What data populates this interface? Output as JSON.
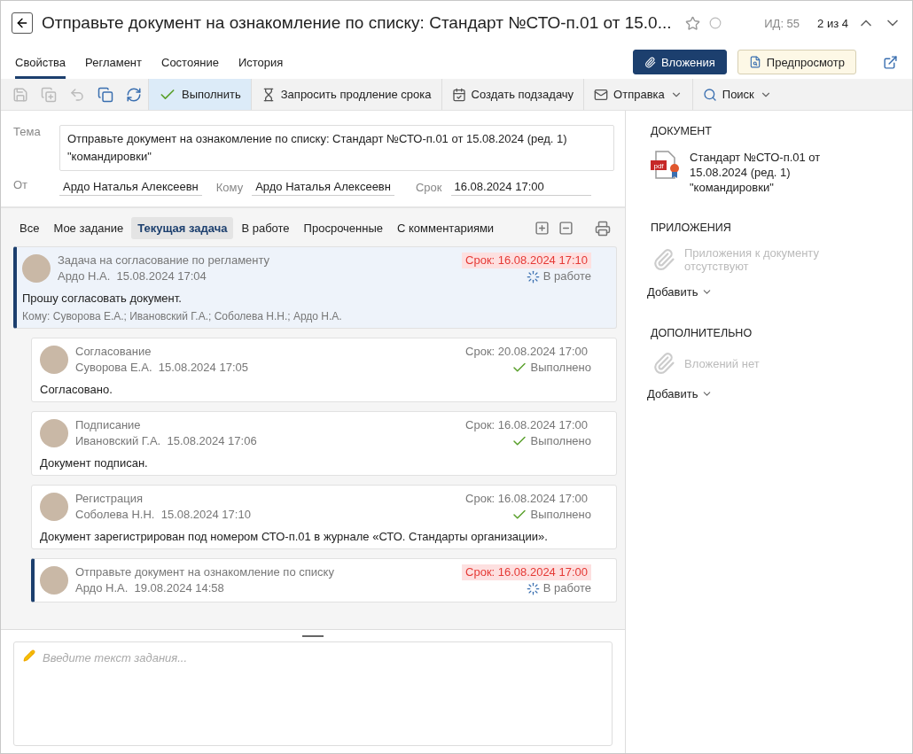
{
  "header": {
    "title": "Отправьте документ на ознакомление по списку: Стандарт №СТО-п.01 от 15.0...",
    "favorite": false,
    "id_label": "ИД: 55",
    "position": "2 из 4"
  },
  "tabs": [
    {
      "label": "Свойства",
      "selected": true
    },
    {
      "label": "Регламент",
      "selected": false
    },
    {
      "label": "Состояние",
      "selected": false
    },
    {
      "label": "История",
      "selected": false
    }
  ],
  "header_buttons": [
    {
      "label": "Вложения",
      "kind": "primary"
    },
    {
      "label": "Предпросмотр",
      "kind": "secondary"
    }
  ],
  "toolbar": [
    {
      "kind": "icon",
      "disabled": true
    },
    {
      "kind": "icon",
      "disabled": true
    },
    {
      "kind": "icon",
      "disabled": true
    },
    {
      "kind": "icon",
      "disabled": false
    },
    {
      "kind": "icon",
      "disabled": false
    },
    {
      "kind": "action",
      "label": "Выполнить",
      "selected": true,
      "menu": false
    },
    {
      "kind": "action",
      "label": "Запросить продление срока",
      "selected": false,
      "menu": false
    },
    {
      "kind": "action",
      "label": "Создать подзадачу",
      "selected": false,
      "menu": false
    },
    {
      "kind": "action",
      "label": "Отправка",
      "selected": false,
      "menu": true
    },
    {
      "kind": "action",
      "label": "Поиск",
      "selected": false,
      "menu": true
    }
  ],
  "form": {
    "subject_label": "Тема",
    "subject": "Отправьте документ на ознакомление по списку: Стандарт №СТО-п.01 от 15.08.2024 (ред. 1) \"командировки\"",
    "from_label": "От",
    "from": "Ардо Наталья Алексеевн",
    "to_label": "Кому",
    "to": "Ардо Наталья Алексеевн",
    "deadline_label": "Срок",
    "deadline": "16.08.2024 17:00"
  },
  "filters": [
    {
      "label": "Все",
      "selected": false
    },
    {
      "label": "Мое задание",
      "selected": false
    },
    {
      "label": "Текущая задача",
      "selected": true
    },
    {
      "label": "В работе",
      "selected": false
    },
    {
      "label": "Просроченные",
      "selected": false
    },
    {
      "label": "С комментариями",
      "selected": false
    }
  ],
  "tasks": [
    {
      "title": "Задача на согласование по регламенту",
      "author": "Ардо Н.А.",
      "date": "15.08.2024 17:04",
      "deadline": "Срок: 16.08.2024 17:10",
      "overdue": true,
      "status": "В работе",
      "done": false,
      "selected": true,
      "marked": true,
      "comment": "Прошу согласовать документ.",
      "recipients": "Кому: Суворова Е.А.; Ивановский Г.А.; Соболева Н.Н.; Ардо Н.А.",
      "children": [
        {
          "title": "Согласование",
          "author": "Суворова Е.А.",
          "date": "15.08.2024 17:05",
          "deadline": "Срок: 20.08.2024 17:00",
          "overdue": false,
          "status": "Выполнено",
          "done": true,
          "selected": false,
          "marked": false,
          "comment": "Согласовано."
        },
        {
          "title": "Подписание",
          "author": "Ивановский Г.А.",
          "date": "15.08.2024 17:06",
          "deadline": "Срок: 16.08.2024 17:00",
          "overdue": false,
          "status": "Выполнено",
          "done": true,
          "selected": false,
          "marked": false,
          "comment": "Документ подписан."
        },
        {
          "title": "Регистрация",
          "author": "Соболева Н.Н.",
          "date": "15.08.2024 17:10",
          "deadline": "Срок: 16.08.2024 17:00",
          "overdue": false,
          "status": "Выполнено",
          "done": true,
          "selected": false,
          "marked": false,
          "comment": "Документ зарегистрирован под номером СТО-п.01 в журнале «СТО. Стандарты организации»."
        },
        {
          "title": "Отправьте документ на ознакомление по списку",
          "author": "Ардо Н.А.",
          "date": "19.08.2024 14:58",
          "deadline": "Срок: 16.08.2024 17:00",
          "overdue": true,
          "status": "В работе",
          "done": false,
          "selected": false,
          "marked": true
        }
      ]
    }
  ],
  "editor": {
    "placeholder": "Введите текст задания..."
  },
  "side": {
    "document_heading": "ДОКУМЕНТ",
    "document": "Стандарт №СТО-п.01 от 15.08.2024 (ред. 1) \"командировки\"",
    "document_badge": "pdf",
    "sections": [
      {
        "heading": "ПРИЛОЖЕНИЯ",
        "empty": "Приложения к документу отсутствуют",
        "add": "Добавить"
      },
      {
        "heading": "ДОПОЛНИТЕЛЬНО",
        "empty": "Вложений нет",
        "add": "Добавить"
      }
    ]
  }
}
